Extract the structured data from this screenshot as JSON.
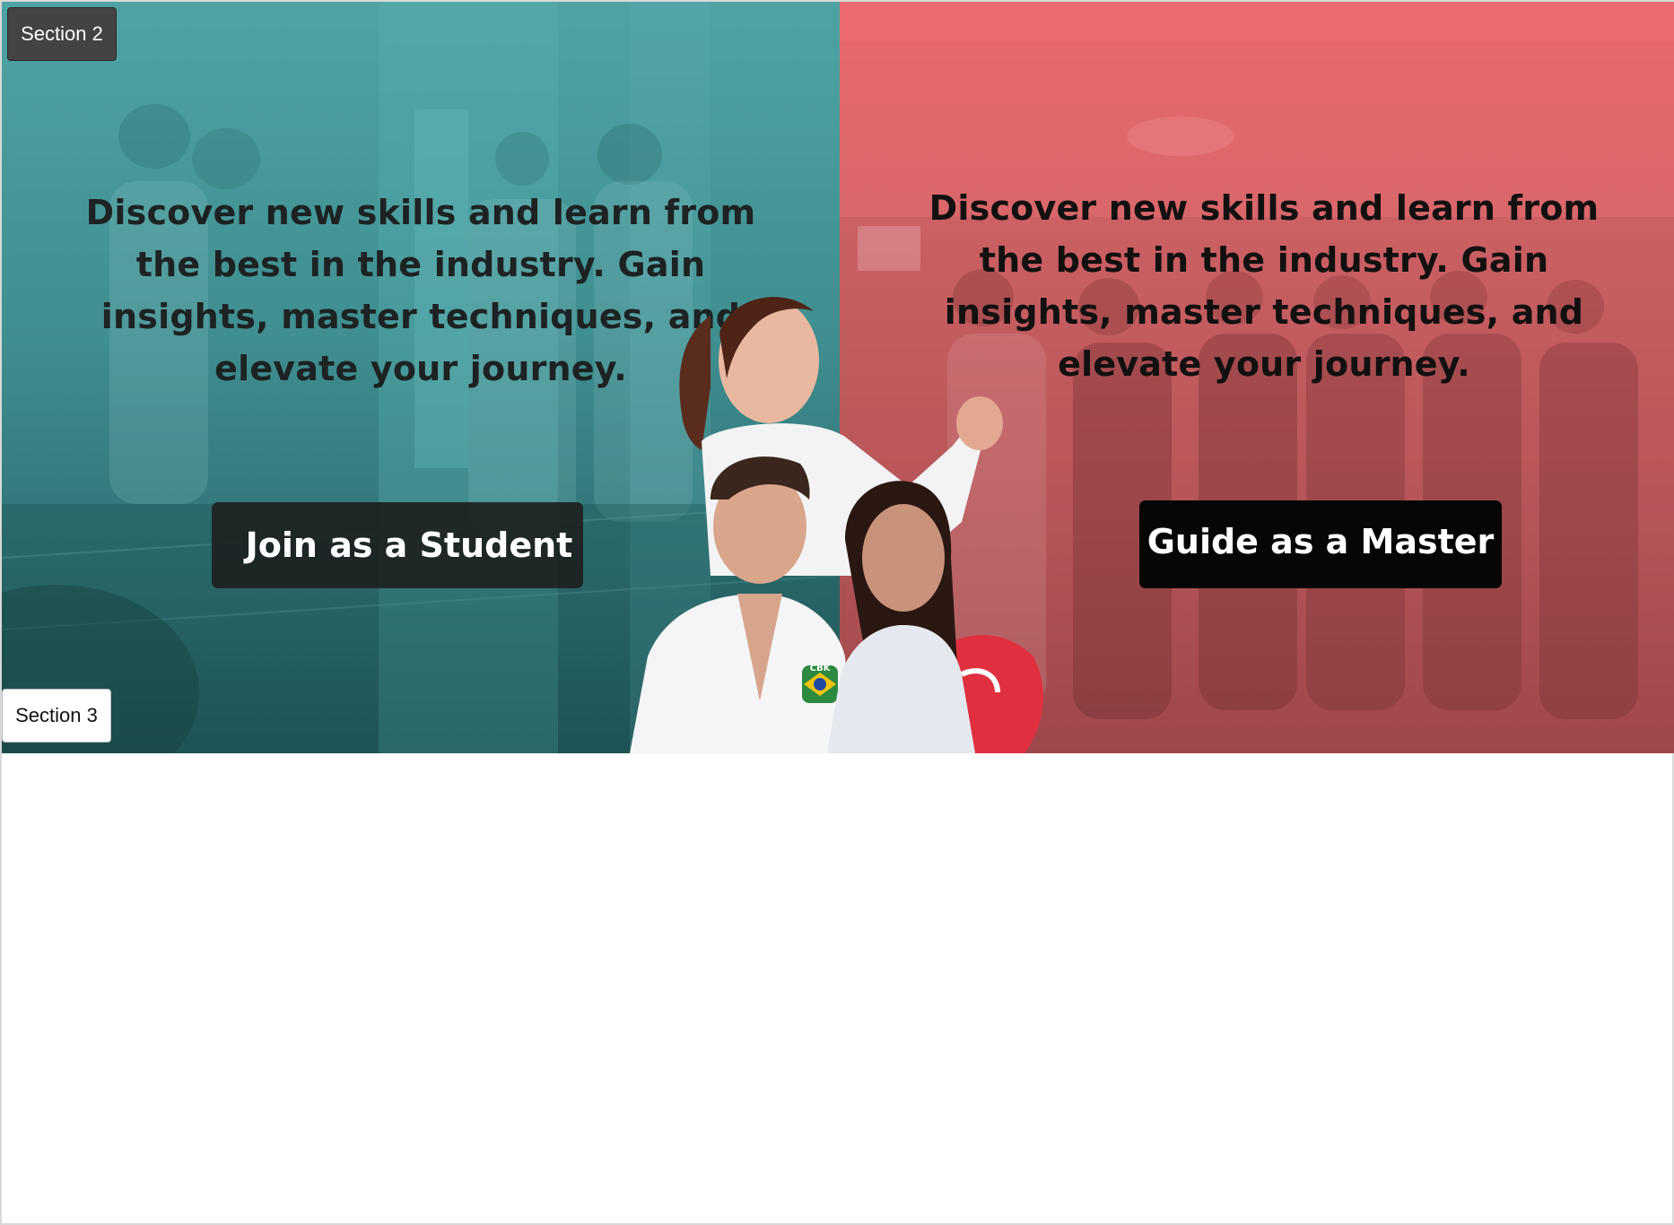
{
  "section_tags": {
    "section_2": "Section 2",
    "section_3": "Section 3"
  },
  "hero": {
    "left": {
      "text": "Discover new skills and learn from the best in the industry. Gain insights, master techniques, and elevate your journey.",
      "button_label": "Join as a Student",
      "color": "#4fa3a5"
    },
    "right": {
      "text": "Discover new skills and learn from the best in the industry. Gain insights, master techniques, and elevate your journey.",
      "button_label": "Guide as a Master",
      "color": "#e9686b"
    }
  },
  "illustration": {
    "icon": "martial-arts-fighters-image",
    "badge_text": "CBK"
  }
}
